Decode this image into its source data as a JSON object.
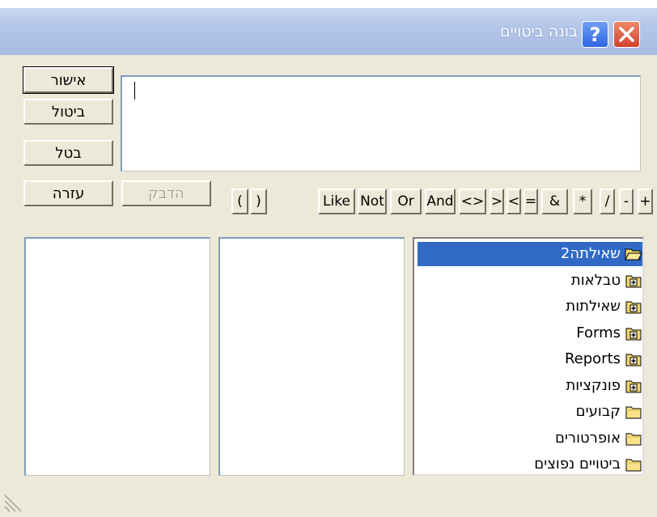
{
  "window": {
    "title": "בונה ביטויים"
  },
  "buttons": {
    "ok": "אישור",
    "cancel": "ביטול",
    "undo": "בטל",
    "paste": "הדבק",
    "help": "עזרה"
  },
  "expression": {
    "value": ""
  },
  "operators": [
    "+",
    "-",
    "/",
    "*",
    "&",
    "=",
    "<",
    ">",
    "<>",
    "And",
    "Or",
    "Not",
    "Like",
    "(",
    ")"
  ],
  "tree": [
    {
      "label": "שאילתה2",
      "icon": "open-folder-icon",
      "selected": true
    },
    {
      "label": "טבלאות",
      "icon": "expand-folder-icon"
    },
    {
      "label": "שאילתות",
      "icon": "expand-folder-icon"
    },
    {
      "label": "Forms",
      "icon": "expand-folder-icon"
    },
    {
      "label": "Reports",
      "icon": "expand-folder-icon"
    },
    {
      "label": "פונקציות",
      "icon": "expand-folder-icon"
    },
    {
      "label": "קבועים",
      "icon": "folder-icon"
    },
    {
      "label": "אופרטורים",
      "icon": "folder-icon"
    },
    {
      "label": "ביטויים נפוצים",
      "icon": "folder-icon"
    }
  ],
  "colors": {
    "selection": "#316ac5",
    "dialog": "#ece9d8"
  }
}
